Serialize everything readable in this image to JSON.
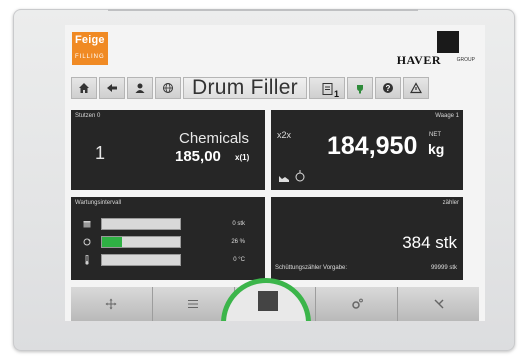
{
  "brand": {
    "feige_name": "Feige",
    "feige_sub": "FILLING",
    "haver_name": "HAVER",
    "haver_group": "GROUP"
  },
  "toolbar": {
    "title": "Drum Filler",
    "badge_count": "1",
    "icons": [
      "home-icon",
      "back-icon",
      "user-icon",
      "globe-icon",
      "clipboard-icon",
      "plug-icon",
      "help-icon",
      "warning-icon"
    ]
  },
  "panels": {
    "stutzen": {
      "label": "Stutzen 0",
      "number": "1",
      "product": "Chemicals",
      "target_value": "185,00",
      "target_unit": "x(1)"
    },
    "waage": {
      "label": "Waage 1",
      "mode_symbol": "x2x",
      "weight": "184,950",
      "net_label": "NET",
      "unit": "kg"
    },
    "wartung": {
      "label": "Wartungsintervall",
      "rows": [
        {
          "icon": "calendar-icon",
          "fraction": 0,
          "value": "0 stk"
        },
        {
          "icon": "cycle-icon",
          "fraction": 0.26,
          "value": "26 %"
        },
        {
          "icon": "thermometer-icon",
          "fraction": 0,
          "value": "0 °C"
        }
      ]
    },
    "zaehler": {
      "label": "zähler",
      "count": "384 stk",
      "preset_label": "Schüttungszähler Vorgabe:",
      "preset_value": "99999 stk"
    }
  },
  "bottom_bar": {
    "icons": [
      "move-icon",
      "list-icon",
      "stop-icon",
      "settings-icon",
      "tools-icon"
    ]
  },
  "colors": {
    "accent_green": "#3bb54a",
    "panel_bg": "#262626",
    "feige_orange": "#f08a24"
  }
}
